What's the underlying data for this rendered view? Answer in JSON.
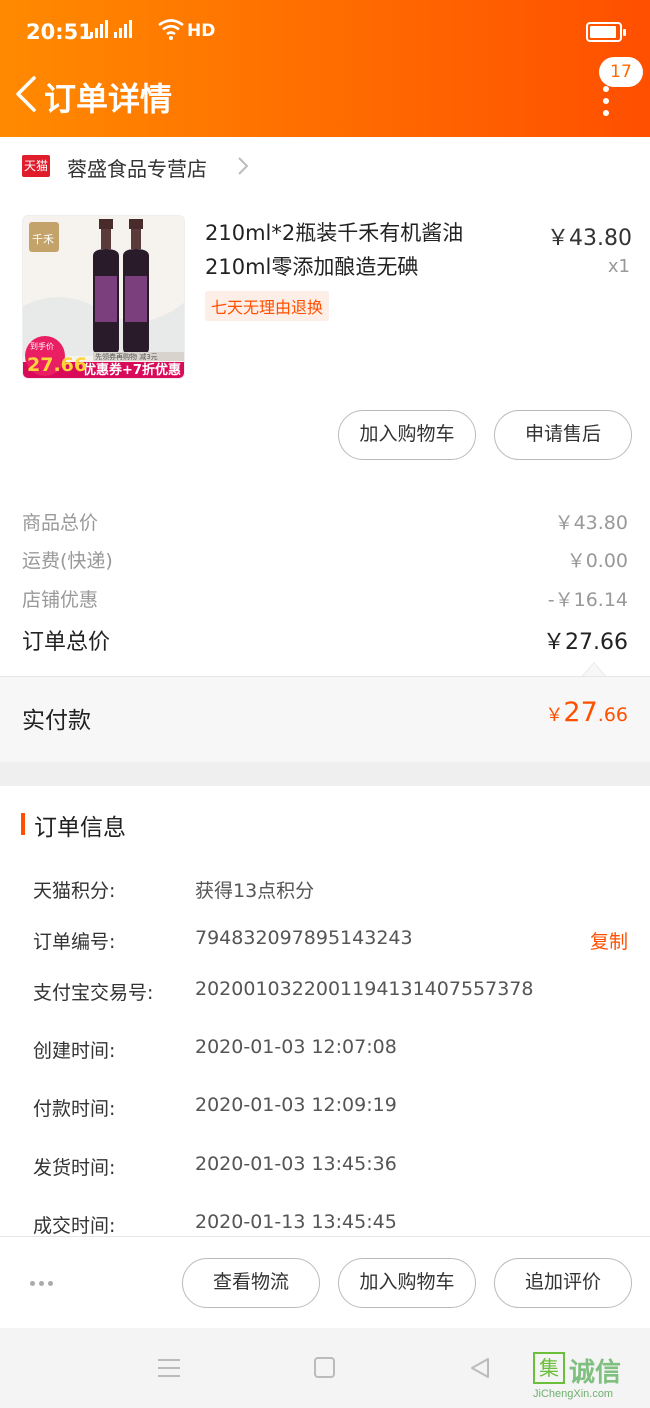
{
  "status_bar": {
    "time": "20:51",
    "network": "4G 4G",
    "hd": "HD",
    "battery_level": 0.85
  },
  "header": {
    "title": "订单详情",
    "message_count": "17",
    "background": "#ff6a00"
  },
  "store": {
    "badge": "天猫",
    "name": "蓉盛食品专营店"
  },
  "product": {
    "title": "210ml*2瓶装千禾有机酱油210ml零添加酿造无碘",
    "tag": "七天无理由退换",
    "price": "￥43.80",
    "quantity": "x1",
    "image": {
      "brand": "千禾",
      "promo_label": "到手价",
      "promo_price": "27.66",
      "promo_note": "先领券再购物 减3元",
      "promo_banner": "优惠券+7折优惠"
    },
    "actions": {
      "add_cart": "加入购物车",
      "after_sale": "申请售后"
    }
  },
  "summary": {
    "goods_total_label": "商品总价",
    "goods_total": "￥43.80",
    "shipping_label": "运费(快递)",
    "shipping": "￥0.00",
    "discount_label": "店铺优惠",
    "discount": "-￥16.14",
    "order_total_label": "订单总价",
    "order_total": "￥27.66"
  },
  "payment": {
    "label": "实付款",
    "symbol": "￥",
    "integer": "27",
    "decimal": ".66",
    "accent": "#ff5000"
  },
  "order_info": {
    "title": "订单信息",
    "rows": [
      {
        "key": "天猫积分:",
        "value": "获得13点积分"
      },
      {
        "key": "订单编号:",
        "value": "794832097895143243"
      },
      {
        "key": "支付宝交易号:",
        "value": "2020010322001194131407557378"
      },
      {
        "key": "创建时间:",
        "value": "2020-01-03 12:07:08"
      },
      {
        "key": "付款时间:",
        "value": "2020-01-03 12:09:19"
      },
      {
        "key": "发货时间:",
        "value": "2020-01-03 13:45:36"
      },
      {
        "key": "成交时间:",
        "value": "2020-01-13 13:45:45"
      }
    ],
    "copy": "复制"
  },
  "bottom_actions": {
    "logistics": "查看物流",
    "add_cart": "加入购物车",
    "review": "追加评价"
  },
  "watermark": {
    "char": "集",
    "text": "诚信",
    "url": "JiChengXin.com"
  }
}
